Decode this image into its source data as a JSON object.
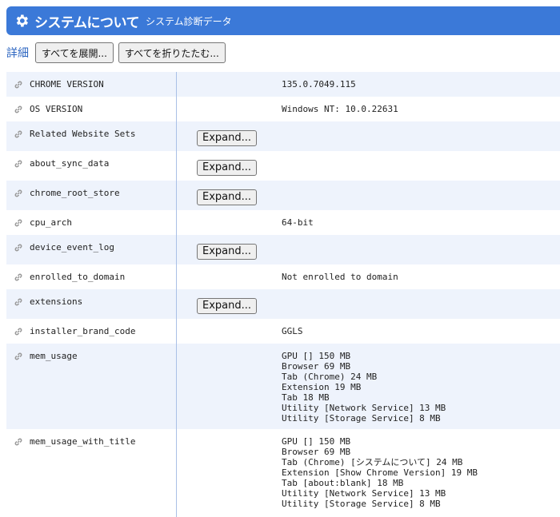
{
  "header": {
    "title": "システムについて",
    "subtitle": "システム診断データ"
  },
  "toolbar": {
    "label": "詳細",
    "expand_all": "すべてを展開...",
    "collapse_all": "すべてを折りたたむ..."
  },
  "expand_label": "Expand...",
  "rows": [
    {
      "key": "CHROME VERSION",
      "value": "135.0.7049.115"
    },
    {
      "key": "OS VERSION",
      "value": "Windows NT: 10.0.22631"
    },
    {
      "key": "Related Website Sets",
      "value": ""
    },
    {
      "key": "about_sync_data",
      "value": ""
    },
    {
      "key": "chrome_root_store",
      "value": ""
    },
    {
      "key": "cpu_arch",
      "value": "64-bit"
    },
    {
      "key": "device_event_log",
      "value": ""
    },
    {
      "key": "enrolled_to_domain",
      "value": "Not enrolled to domain"
    },
    {
      "key": "extensions",
      "value": ""
    },
    {
      "key": "installer_brand_code",
      "value": "GGLS"
    },
    {
      "key": "mem_usage",
      "value": "GPU [] 150 MB\nBrowser 69 MB\nTab (Chrome) 24 MB\nExtension 19 MB\nTab 18 MB\nUtility [Network Service] 13 MB\nUtility [Storage Service] 8 MB"
    },
    {
      "key": "mem_usage_with_title",
      "value": "GPU [] 150 MB\nBrowser 69 MB\nTab (Chrome) [システムについて] 24 MB\nExtension [Show Chrome Version] 19 MB\nTab [about:blank] 18 MB\nUtility [Network Service] 13 MB\nUtility [Storage Service] 8 MB"
    }
  ]
}
